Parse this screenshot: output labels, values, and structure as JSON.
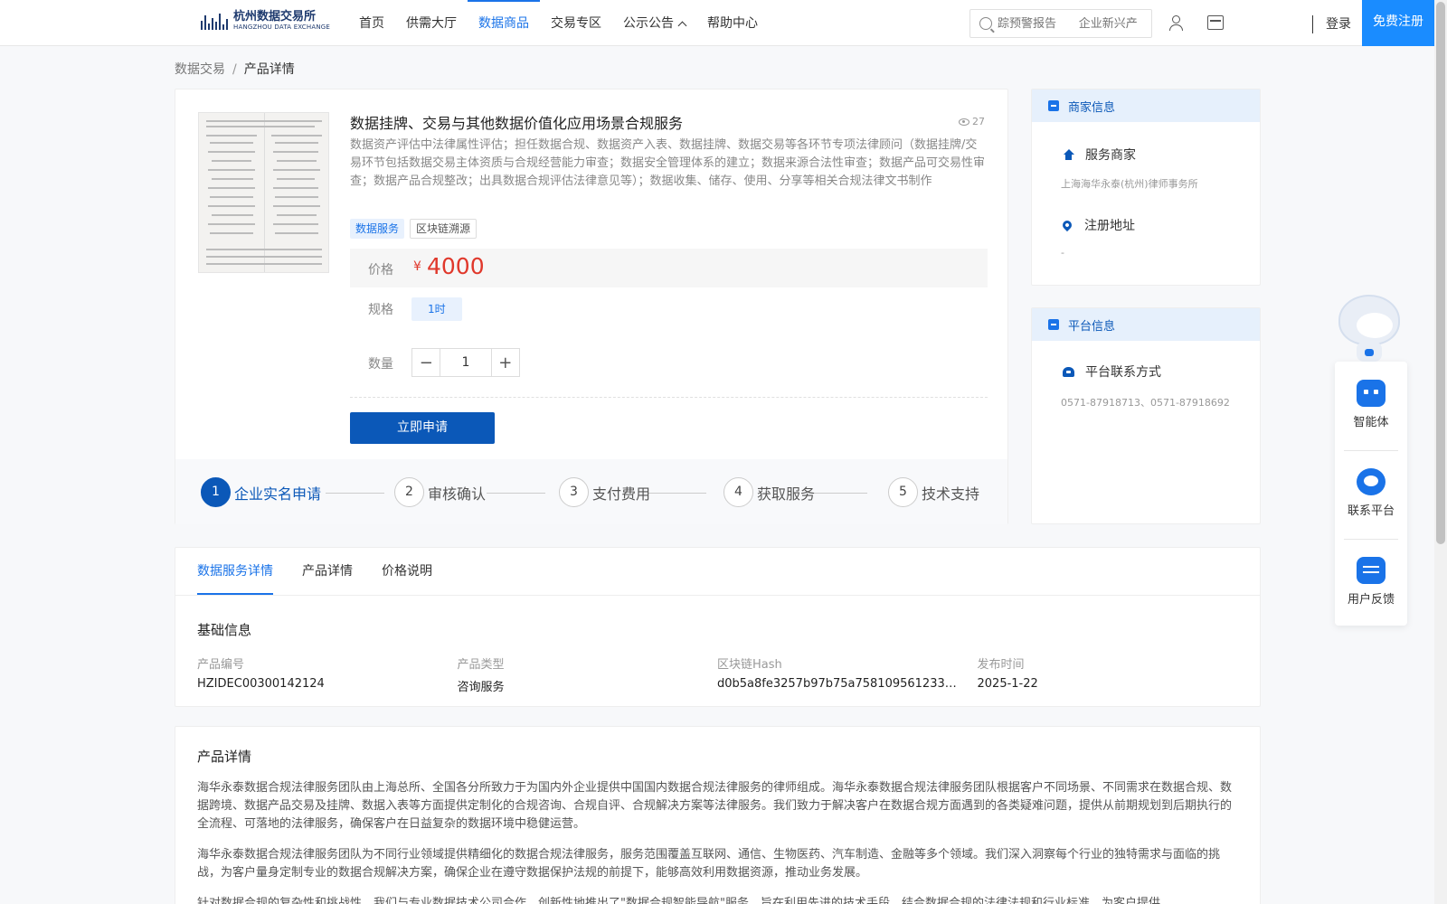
{
  "header": {
    "logo_cn": "杭州数据交易所",
    "logo_en": "HANGZHOU DATA EXCHANGE",
    "nav": [
      {
        "label": "首页"
      },
      {
        "label": "供需大厅"
      },
      {
        "label": "数据商品"
      },
      {
        "label": "交易专区"
      },
      {
        "label": "公示公告"
      },
      {
        "label": "帮助中心"
      }
    ],
    "active_nav": "数据商品",
    "search_placeholder": "踪预警报告      企业新兴产",
    "login": "登录",
    "register": "免费注册"
  },
  "breadcrumb": {
    "root": "数据交易",
    "sep": "/",
    "current": "产品详情"
  },
  "product": {
    "title": "数据挂牌、交易与其他数据价值化应用场景合规服务",
    "views": "27",
    "description": "数据资产评估中法律属性评估；担任数据合规、数据资产入表、数据挂牌、数据交易等各环节专项法律顾问（数据挂牌/交易环节包括数据交易主体资质与合规经营能力审查；数据安全管理体系的建立；数据来源合法性审查；数据产品可交易性审查；数据产品合规整改；出具数据合规评估法律意见等）；数据收集、储存、使用、分享等相关合规法律文书制作",
    "tags": [
      "数据服务",
      "区块链溯源"
    ],
    "price_label": "价格",
    "currency": "¥",
    "price": "4000",
    "spec_label": "规格",
    "spec_value": "1时",
    "qty_label": "数量",
    "qty_minus": "−",
    "qty_value": "1",
    "qty_plus": "+",
    "apply": "立即申请"
  },
  "steps": [
    {
      "num": "1",
      "label": "企业实名申请"
    },
    {
      "num": "2",
      "label": "审核确认"
    },
    {
      "num": "3",
      "label": "支付费用"
    },
    {
      "num": "4",
      "label": "获取服务"
    },
    {
      "num": "5",
      "label": "技术支持"
    }
  ],
  "merchant": {
    "header": "商家信息",
    "service_label": "服务商家",
    "service_value": "上海海华永泰(杭州)律师事务所",
    "address_label": "注册地址",
    "address_value": "-"
  },
  "platform": {
    "header": "平台信息",
    "contact_label": "平台联系方式",
    "contact_value": "0571-87918713、0571-87918692"
  },
  "float": {
    "agent": "智能体",
    "contact": "联系平台",
    "feedback": "用户反馈"
  },
  "tabs": [
    {
      "label": "数据服务详情"
    },
    {
      "label": "产品详情"
    },
    {
      "label": "价格说明"
    }
  ],
  "basic_info": {
    "title": "基础信息",
    "fields": [
      {
        "key": "产品编号",
        "value": "HZIDEC00300142124"
      },
      {
        "key": "产品类型",
        "value": "咨询服务"
      },
      {
        "key": "区块链Hash",
        "value": "d0b5a8fe3257b97b75a7581095612333a9…"
      },
      {
        "key": "发布时间",
        "value": "2025-1-22"
      }
    ]
  },
  "detail": {
    "title": "产品详情",
    "paragraphs": [
      "海华永泰数据合规法律服务团队由上海总所、全国各分所致力于为国内外企业提供中国国内数据合规法律服务的律师组成。海华永泰数据合规法律服务团队根据客户不同场景、不同需求在数据合规、数据跨境、数据产品交易及挂牌、数据入表等方面提供定制化的合规咨询、合规自评、合规解决方案等法律服务。我们致力于解决客户在数据合规方面遇到的各类疑难问题，提供从前期规划到后期执行的全流程、可落地的法律服务，确保客户在日益复杂的数据环境中稳健运营。",
      "海华永泰数据合规法律服务团队为不同行业领域提供精细化的数据合规法律服务，服务范围覆盖互联网、通信、生物医药、汽车制造、金融等多个领域。我们深入洞察每个行业的独特需求与面临的挑战，为客户量身定制专业的数据合规解决方案，确保企业在遵守数据保护法规的前提下，能够高效利用数据资源，推动业务发展。",
      "针对数据合规的复杂性和挑战性，我们与专业数据技术公司合作，创新性地推出了\"数据合规智能导航\"服务，旨在利用先进的技术手段，结合数据合规的法律法规和行业标准，为客户提供"
    ]
  },
  "colors": {
    "primary": "#1a73e8",
    "dark_blue": "#0b58b8",
    "price_red": "#e0382b",
    "register_bg": "#1a8cff"
  }
}
